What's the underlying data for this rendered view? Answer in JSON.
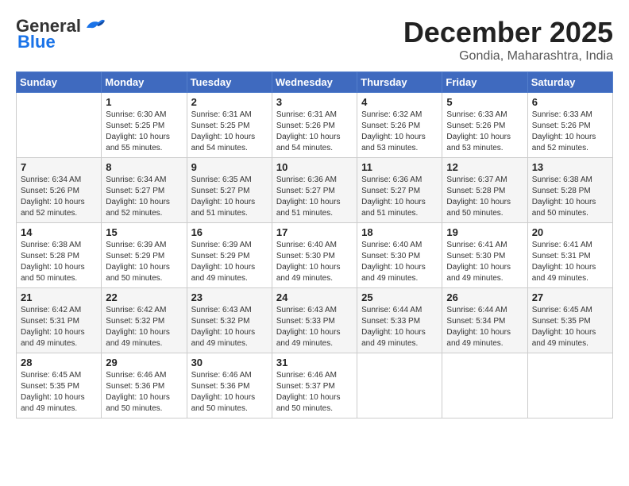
{
  "logo": {
    "line1": "General",
    "line2": "Blue"
  },
  "header": {
    "month_year": "December 2025",
    "location": "Gondia, Maharashtra, India"
  },
  "weekdays": [
    "Sunday",
    "Monday",
    "Tuesday",
    "Wednesday",
    "Thursday",
    "Friday",
    "Saturday"
  ],
  "weeks": [
    [
      {
        "day": "",
        "info": ""
      },
      {
        "day": "1",
        "info": "Sunrise: 6:30 AM\nSunset: 5:25 PM\nDaylight: 10 hours\nand 55 minutes."
      },
      {
        "day": "2",
        "info": "Sunrise: 6:31 AM\nSunset: 5:25 PM\nDaylight: 10 hours\nand 54 minutes."
      },
      {
        "day": "3",
        "info": "Sunrise: 6:31 AM\nSunset: 5:26 PM\nDaylight: 10 hours\nand 54 minutes."
      },
      {
        "day": "4",
        "info": "Sunrise: 6:32 AM\nSunset: 5:26 PM\nDaylight: 10 hours\nand 53 minutes."
      },
      {
        "day": "5",
        "info": "Sunrise: 6:33 AM\nSunset: 5:26 PM\nDaylight: 10 hours\nand 53 minutes."
      },
      {
        "day": "6",
        "info": "Sunrise: 6:33 AM\nSunset: 5:26 PM\nDaylight: 10 hours\nand 52 minutes."
      }
    ],
    [
      {
        "day": "7",
        "info": "Sunrise: 6:34 AM\nSunset: 5:26 PM\nDaylight: 10 hours\nand 52 minutes."
      },
      {
        "day": "8",
        "info": "Sunrise: 6:34 AM\nSunset: 5:27 PM\nDaylight: 10 hours\nand 52 minutes."
      },
      {
        "day": "9",
        "info": "Sunrise: 6:35 AM\nSunset: 5:27 PM\nDaylight: 10 hours\nand 51 minutes."
      },
      {
        "day": "10",
        "info": "Sunrise: 6:36 AM\nSunset: 5:27 PM\nDaylight: 10 hours\nand 51 minutes."
      },
      {
        "day": "11",
        "info": "Sunrise: 6:36 AM\nSunset: 5:27 PM\nDaylight: 10 hours\nand 51 minutes."
      },
      {
        "day": "12",
        "info": "Sunrise: 6:37 AM\nSunset: 5:28 PM\nDaylight: 10 hours\nand 50 minutes."
      },
      {
        "day": "13",
        "info": "Sunrise: 6:38 AM\nSunset: 5:28 PM\nDaylight: 10 hours\nand 50 minutes."
      }
    ],
    [
      {
        "day": "14",
        "info": "Sunrise: 6:38 AM\nSunset: 5:28 PM\nDaylight: 10 hours\nand 50 minutes."
      },
      {
        "day": "15",
        "info": "Sunrise: 6:39 AM\nSunset: 5:29 PM\nDaylight: 10 hours\nand 50 minutes."
      },
      {
        "day": "16",
        "info": "Sunrise: 6:39 AM\nSunset: 5:29 PM\nDaylight: 10 hours\nand 49 minutes."
      },
      {
        "day": "17",
        "info": "Sunrise: 6:40 AM\nSunset: 5:30 PM\nDaylight: 10 hours\nand 49 minutes."
      },
      {
        "day": "18",
        "info": "Sunrise: 6:40 AM\nSunset: 5:30 PM\nDaylight: 10 hours\nand 49 minutes."
      },
      {
        "day": "19",
        "info": "Sunrise: 6:41 AM\nSunset: 5:30 PM\nDaylight: 10 hours\nand 49 minutes."
      },
      {
        "day": "20",
        "info": "Sunrise: 6:41 AM\nSunset: 5:31 PM\nDaylight: 10 hours\nand 49 minutes."
      }
    ],
    [
      {
        "day": "21",
        "info": "Sunrise: 6:42 AM\nSunset: 5:31 PM\nDaylight: 10 hours\nand 49 minutes."
      },
      {
        "day": "22",
        "info": "Sunrise: 6:42 AM\nSunset: 5:32 PM\nDaylight: 10 hours\nand 49 minutes."
      },
      {
        "day": "23",
        "info": "Sunrise: 6:43 AM\nSunset: 5:32 PM\nDaylight: 10 hours\nand 49 minutes."
      },
      {
        "day": "24",
        "info": "Sunrise: 6:43 AM\nSunset: 5:33 PM\nDaylight: 10 hours\nand 49 minutes."
      },
      {
        "day": "25",
        "info": "Sunrise: 6:44 AM\nSunset: 5:33 PM\nDaylight: 10 hours\nand 49 minutes."
      },
      {
        "day": "26",
        "info": "Sunrise: 6:44 AM\nSunset: 5:34 PM\nDaylight: 10 hours\nand 49 minutes."
      },
      {
        "day": "27",
        "info": "Sunrise: 6:45 AM\nSunset: 5:35 PM\nDaylight: 10 hours\nand 49 minutes."
      }
    ],
    [
      {
        "day": "28",
        "info": "Sunrise: 6:45 AM\nSunset: 5:35 PM\nDaylight: 10 hours\nand 49 minutes."
      },
      {
        "day": "29",
        "info": "Sunrise: 6:46 AM\nSunset: 5:36 PM\nDaylight: 10 hours\nand 50 minutes."
      },
      {
        "day": "30",
        "info": "Sunrise: 6:46 AM\nSunset: 5:36 PM\nDaylight: 10 hours\nand 50 minutes."
      },
      {
        "day": "31",
        "info": "Sunrise: 6:46 AM\nSunset: 5:37 PM\nDaylight: 10 hours\nand 50 minutes."
      },
      {
        "day": "",
        "info": ""
      },
      {
        "day": "",
        "info": ""
      },
      {
        "day": "",
        "info": ""
      }
    ]
  ]
}
